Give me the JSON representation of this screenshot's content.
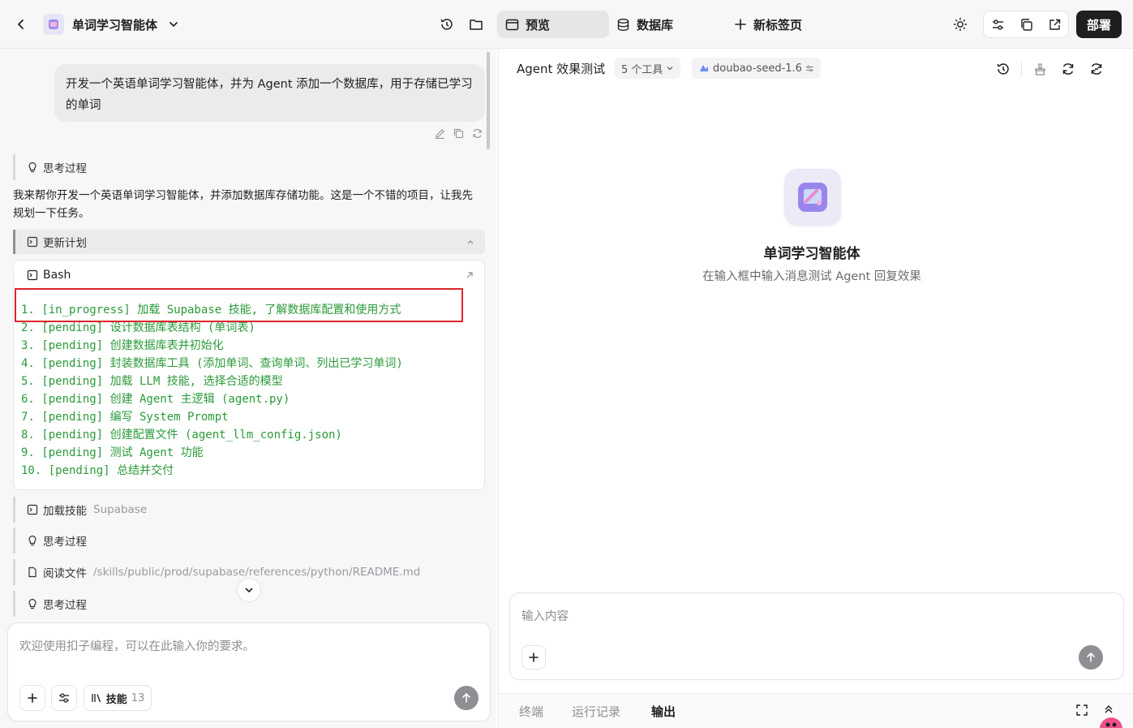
{
  "header": {
    "back_icon": "chevron-left-icon",
    "project_name": "单词学习智能体",
    "tabs": [
      {
        "label": "预览",
        "icon": "window-icon",
        "active": true
      },
      {
        "label": "数据库",
        "icon": "database-icon",
        "active": false
      },
      {
        "label": "新标签页",
        "icon": "plus-icon",
        "active": false
      }
    ],
    "deploy_label": "部署"
  },
  "chat": {
    "user_message": "开发一个英语单词学习智能体，并为 Agent 添加一个数据库，用于存储已学习的单词",
    "thinking_label": "思考过程",
    "assistant_text": "我来帮你开发一个英语单词学习智能体，并添加数据库存储功能。这是一个不错的项目，让我先规划一下任务。",
    "update_plan_label": "更新计划",
    "bash_label": "Bash",
    "plan_lines": [
      "1. [in_progress] 加载 Supabase 技能, 了解数据库配置和使用方式",
      "2. [pending] 设计数据库表结构 (单词表)",
      "3. [pending] 创建数据库表并初始化",
      "4. [pending] 封装数据库工具 (添加单词、查询单词、列出已学习单词)",
      "5. [pending] 加载 LLM 技能, 选择合适的模型",
      "6. [pending] 创建 Agent 主逻辑 (agent.py)",
      "7. [pending] 编写 System Prompt",
      "8. [pending] 创建配置文件 (agent_llm_config.json)",
      "9. [pending] 测试 Agent 功能",
      "10. [pending] 总结并交付"
    ],
    "load_skill_label": "加载技能",
    "load_skill_name": "Supabase",
    "thinking_label_2": "思考过程",
    "read_file_label": "阅读文件",
    "read_file_path": "/skills/public/prod/supabase/references/python/README.md",
    "thinking_label_3": "思考过程",
    "composer_placeholder": "欢迎使用扣子编程，可以在此输入你的要求。",
    "skills_label": "技能",
    "skills_count": "13"
  },
  "preview": {
    "title": "Agent 效果测试",
    "tools_label": "5 个工具",
    "model_label": "doubao-seed-1.6",
    "agent_name": "单词学习智能体",
    "agent_hint": "在输入框中输入消息测试 Agent 回复效果",
    "input_placeholder": "输入内容",
    "bottom_tabs": [
      {
        "label": "终端",
        "active": false
      },
      {
        "label": "运行记录",
        "active": false
      },
      {
        "label": "输出",
        "active": true
      }
    ]
  },
  "colors": {
    "code_green": "#2b9a3a",
    "highlight_red": "#e0242d",
    "deploy_bg": "#1f1f1f"
  }
}
